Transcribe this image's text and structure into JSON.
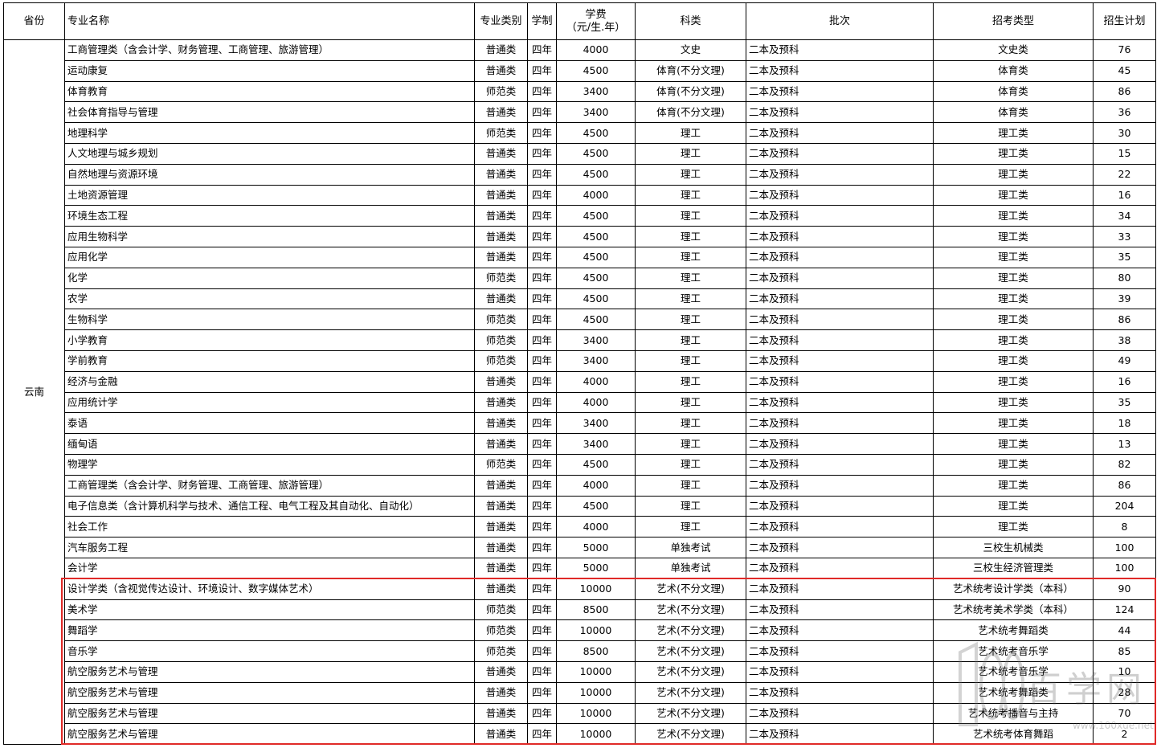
{
  "headers": {
    "province": "省份",
    "major": "专业名称",
    "category": "专业类别",
    "duration": "学制",
    "fee_line1": "学费",
    "fee_line2": "（元/生.年）",
    "subject": "科类",
    "batch": "批次",
    "exam_type": "招考类型",
    "plan": "招生计划"
  },
  "province": "云南",
  "rows": [
    {
      "major": "工商管理类（含会计学、财务管理、工商管理、旅游管理）",
      "category": "普通类",
      "duration": "四年",
      "fee": "4000",
      "subject": "文史",
      "batch": "二本及预科",
      "exam_type": "文史类",
      "plan": "76"
    },
    {
      "major": "运动康复",
      "category": "普通类",
      "duration": "四年",
      "fee": "4500",
      "subject": "体育(不分文理)",
      "batch": "二本及预科",
      "exam_type": "体育类",
      "plan": "45"
    },
    {
      "major": "体育教育",
      "category": "师范类",
      "duration": "四年",
      "fee": "3400",
      "subject": "体育(不分文理)",
      "batch": "二本及预科",
      "exam_type": "体育类",
      "plan": "86"
    },
    {
      "major": "社会体育指导与管理",
      "category": "普通类",
      "duration": "四年",
      "fee": "3400",
      "subject": "体育(不分文理)",
      "batch": "二本及预科",
      "exam_type": "体育类",
      "plan": "36"
    },
    {
      "major": "地理科学",
      "category": "师范类",
      "duration": "四年",
      "fee": "4500",
      "subject": "理工",
      "batch": "二本及预科",
      "exam_type": "理工类",
      "plan": "30"
    },
    {
      "major": "人文地理与城乡规划",
      "category": "普通类",
      "duration": "四年",
      "fee": "4500",
      "subject": "理工",
      "batch": "二本及预科",
      "exam_type": "理工类",
      "plan": "15"
    },
    {
      "major": "自然地理与资源环境",
      "category": "普通类",
      "duration": "四年",
      "fee": "4500",
      "subject": "理工",
      "batch": "二本及预科",
      "exam_type": "理工类",
      "plan": "22"
    },
    {
      "major": "土地资源管理",
      "category": "普通类",
      "duration": "四年",
      "fee": "4000",
      "subject": "理工",
      "batch": "二本及预科",
      "exam_type": "理工类",
      "plan": "16"
    },
    {
      "major": "环境生态工程",
      "category": "普通类",
      "duration": "四年",
      "fee": "4500",
      "subject": "理工",
      "batch": "二本及预科",
      "exam_type": "理工类",
      "plan": "34"
    },
    {
      "major": "应用生物科学",
      "category": "普通类",
      "duration": "四年",
      "fee": "4500",
      "subject": "理工",
      "batch": "二本及预科",
      "exam_type": "理工类",
      "plan": "33"
    },
    {
      "major": "应用化学",
      "category": "普通类",
      "duration": "四年",
      "fee": "4500",
      "subject": "理工",
      "batch": "二本及预科",
      "exam_type": "理工类",
      "plan": "35"
    },
    {
      "major": "化学",
      "category": "师范类",
      "duration": "四年",
      "fee": "4500",
      "subject": "理工",
      "batch": "二本及预科",
      "exam_type": "理工类",
      "plan": "80"
    },
    {
      "major": "农学",
      "category": "普通类",
      "duration": "四年",
      "fee": "4500",
      "subject": "理工",
      "batch": "二本及预科",
      "exam_type": "理工类",
      "plan": "39"
    },
    {
      "major": "生物科学",
      "category": "师范类",
      "duration": "四年",
      "fee": "4500",
      "subject": "理工",
      "batch": "二本及预科",
      "exam_type": "理工类",
      "plan": "86"
    },
    {
      "major": "小学教育",
      "category": "师范类",
      "duration": "四年",
      "fee": "3400",
      "subject": "理工",
      "batch": "二本及预科",
      "exam_type": "理工类",
      "plan": "38"
    },
    {
      "major": "学前教育",
      "category": "师范类",
      "duration": "四年",
      "fee": "3400",
      "subject": "理工",
      "batch": "二本及预科",
      "exam_type": "理工类",
      "plan": "49"
    },
    {
      "major": "经济与金融",
      "category": "普通类",
      "duration": "四年",
      "fee": "4000",
      "subject": "理工",
      "batch": "二本及预科",
      "exam_type": "理工类",
      "plan": "16"
    },
    {
      "major": "应用统计学",
      "category": "普通类",
      "duration": "四年",
      "fee": "4000",
      "subject": "理工",
      "batch": "二本及预科",
      "exam_type": "理工类",
      "plan": "35"
    },
    {
      "major": "泰语",
      "category": "普通类",
      "duration": "四年",
      "fee": "3400",
      "subject": "理工",
      "batch": "二本及预科",
      "exam_type": "理工类",
      "plan": "18"
    },
    {
      "major": "缅甸语",
      "category": "普通类",
      "duration": "四年",
      "fee": "3400",
      "subject": "理工",
      "batch": "二本及预科",
      "exam_type": "理工类",
      "plan": "13"
    },
    {
      "major": "物理学",
      "category": "师范类",
      "duration": "四年",
      "fee": "4500",
      "subject": "理工",
      "batch": "二本及预科",
      "exam_type": "理工类",
      "plan": "82"
    },
    {
      "major": "工商管理类（含会计学、财务管理、工商管理、旅游管理）",
      "category": "普通类",
      "duration": "四年",
      "fee": "4000",
      "subject": "理工",
      "batch": "二本及预科",
      "exam_type": "理工类",
      "plan": "86"
    },
    {
      "major": "电子信息类（含计算机科学与技术、通信工程、电气工程及其自动化、自动化）",
      "category": "普通类",
      "duration": "四年",
      "fee": "4500",
      "subject": "理工",
      "batch": "二本及预科",
      "exam_type": "理工类",
      "plan": "204"
    },
    {
      "major": "社会工作",
      "category": "普通类",
      "duration": "四年",
      "fee": "4000",
      "subject": "理工",
      "batch": "二本及预科",
      "exam_type": "理工类",
      "plan": "8"
    },
    {
      "major": "汽车服务工程",
      "category": "普通类",
      "duration": "四年",
      "fee": "5000",
      "subject": "单独考试",
      "batch": "二本及预科",
      "exam_type": "三校生机械类",
      "plan": "100"
    },
    {
      "major": "会计学",
      "category": "普通类",
      "duration": "四年",
      "fee": "5000",
      "subject": "单独考试",
      "batch": "二本及预科",
      "exam_type": "三校生经济管理类",
      "plan": "100"
    },
    {
      "major": "设计学类（含视觉传达设计、环境设计、数字媒体艺术）",
      "category": "普通类",
      "duration": "四年",
      "fee": "10000",
      "subject": "艺术(不分文理)",
      "batch": "二本及预科",
      "exam_type": "艺术统考设计学类（本科）",
      "plan": "90"
    },
    {
      "major": "美术学",
      "category": "师范类",
      "duration": "四年",
      "fee": "8500",
      "subject": "艺术(不分文理)",
      "batch": "二本及预科",
      "exam_type": "艺术统考美术学类（本科）",
      "plan": "124"
    },
    {
      "major": "舞蹈学",
      "category": "师范类",
      "duration": "四年",
      "fee": "10000",
      "subject": "艺术(不分文理)",
      "batch": "二本及预科",
      "exam_type": "艺术统考舞蹈类",
      "plan": "44"
    },
    {
      "major": "音乐学",
      "category": "师范类",
      "duration": "四年",
      "fee": "8500",
      "subject": "艺术(不分文理)",
      "batch": "二本及预科",
      "exam_type": "艺术统考音乐学",
      "plan": "85"
    },
    {
      "major": "航空服务艺术与管理",
      "category": "普通类",
      "duration": "四年",
      "fee": "10000",
      "subject": "艺术(不分文理)",
      "batch": "二本及预科",
      "exam_type": "艺术统考音乐学",
      "plan": "10"
    },
    {
      "major": "航空服务艺术与管理",
      "category": "普通类",
      "duration": "四年",
      "fee": "10000",
      "subject": "艺术(不分文理)",
      "batch": "二本及预科",
      "exam_type": "艺术统考舞蹈类",
      "plan": "28"
    },
    {
      "major": "航空服务艺术与管理",
      "category": "普通类",
      "duration": "四年",
      "fee": "10000",
      "subject": "艺术(不分文理)",
      "batch": "二本及预科",
      "exam_type": "艺术统考播音与主持",
      "plan": "70"
    },
    {
      "major": "航空服务艺术与管理",
      "category": "普通类",
      "duration": "四年",
      "fee": "10000",
      "subject": "艺术(不分文理)",
      "batch": "二本及预科",
      "exam_type": "艺术统考体育舞蹈",
      "plan": "2"
    }
  ],
  "watermark": {
    "site_name": "百学网",
    "url": "www.100xue.net",
    "logo_text": "100"
  },
  "colors": {
    "highlight_border": "#e02a28",
    "grid": "#000000"
  }
}
